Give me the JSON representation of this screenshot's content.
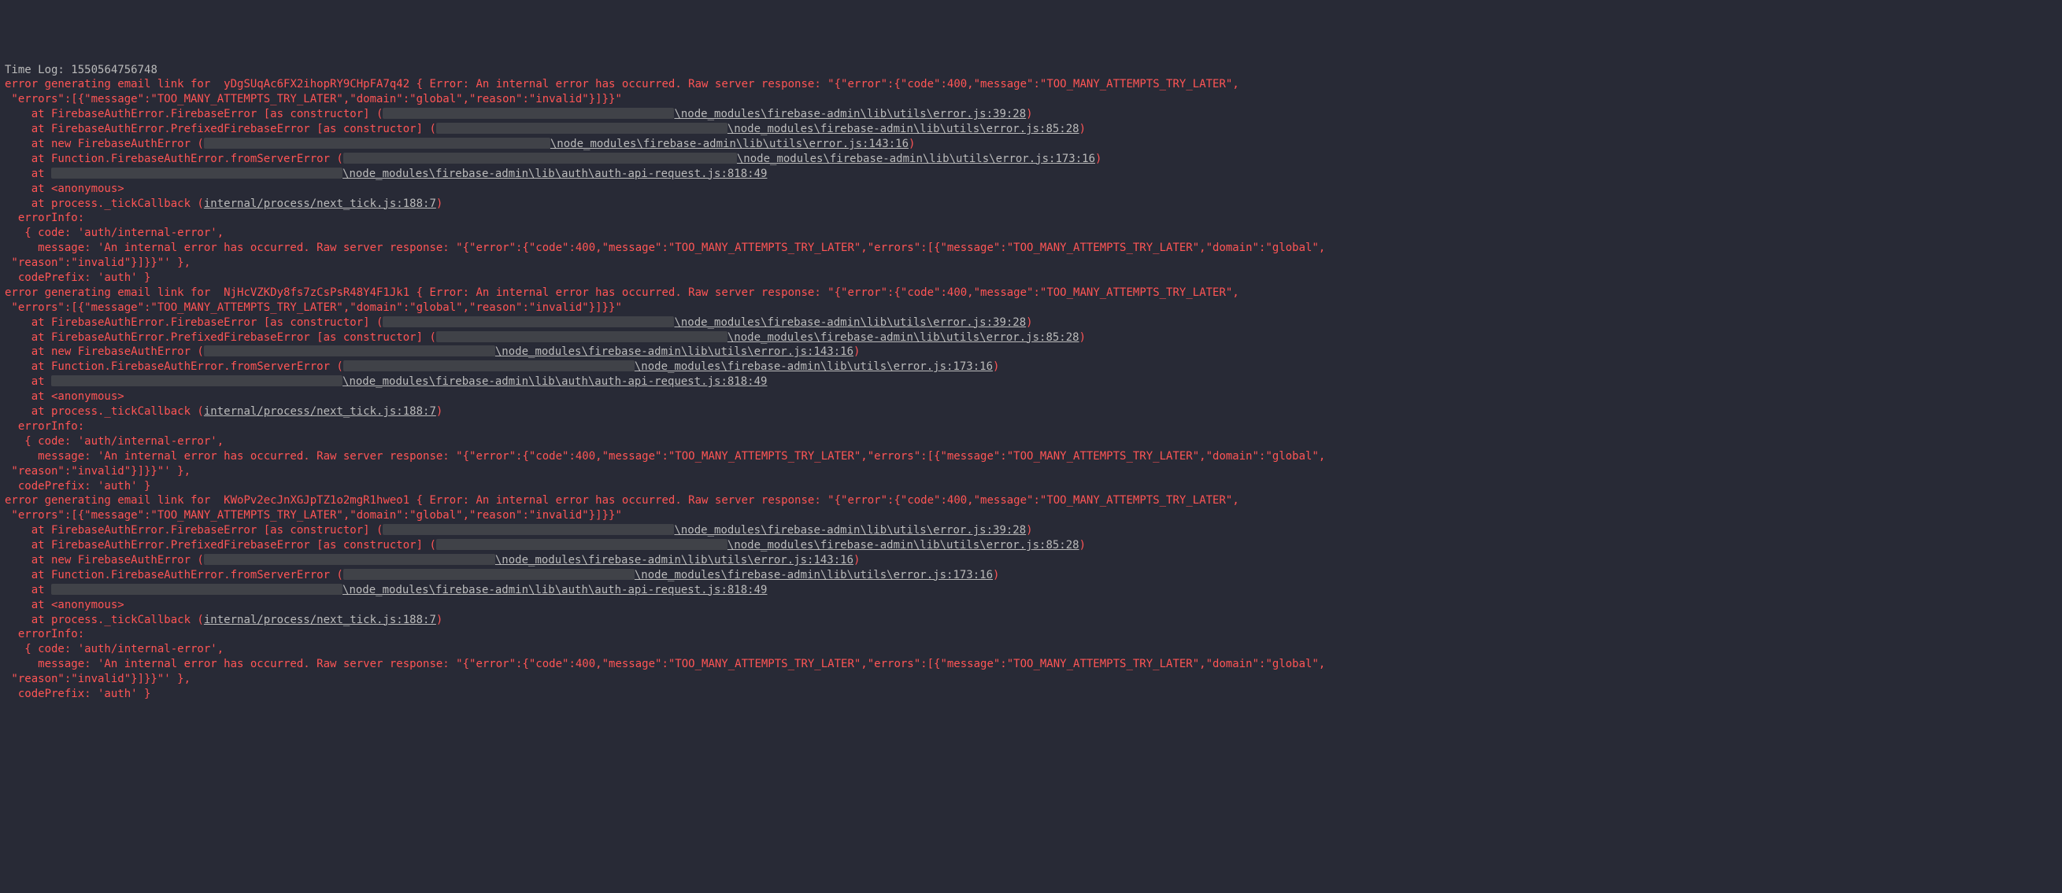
{
  "timeLabel": "Time Log: ",
  "timestamp": "1550564756748",
  "tickCallbackLink": "internal/process/next_tick.js:188:7",
  "errors": [
    {
      "userId": "yDgSUqAc6FX2ihopRY9CHpFA7q42",
      "head1": "error generating email link for  ",
      "head2": " { Error: An internal error has occurred. Raw server response: \"{\"error\":{\"code\":400,\"message\":\"TOO_MANY_ATTEMPTS_TRY_LATER\",",
      "head3": " \"errors\":[{\"message\":\"TOO_MANY_ATTEMPTS_TRY_LATER\",\"domain\":\"global\",\"reason\":\"invalid\"}]}}\"",
      "stack": [
        {
          "prefix": "    at FirebaseAuthError.FirebaseError [as constructor] (",
          "redactW": 370,
          "suffix": "\\node_modules\\firebase-admin\\lib\\utils\\error.js:39:28",
          "tail": ")"
        },
        {
          "prefix": "    at FirebaseAuthError.PrefixedFirebaseError [as constructor] (",
          "redactW": 370,
          "suffix": "\\node_modules\\firebase-admin\\lib\\utils\\error.js:85:28",
          "tail": ")"
        },
        {
          "prefix": "    at new FirebaseAuthError (",
          "redactW": 440,
          "suffix": "\\node_modules\\firebase-admin\\lib\\utils\\error.js:143:16",
          "tail": ")"
        },
        {
          "prefix": "    at Function.FirebaseAuthError.fromServerError (",
          "redactW": 500,
          "suffix": "\\node_modules\\firebase-admin\\lib\\utils\\error.js:173:16",
          "tail": ")"
        },
        {
          "prefix": "    at ",
          "redactW": 370,
          "suffix": "\\node_modules\\firebase-admin\\lib\\auth\\auth-api-request.js:818:49",
          "tail": ""
        },
        {
          "prefix": "    at <anonymous>",
          "redactW": 0,
          "suffix": "",
          "tail": ""
        }
      ],
      "tickLine": "    at process._tickCallback (",
      "tickTail": ")",
      "infoLine": "  errorInfo:",
      "codeLine": "   { code: 'auth/internal-error',",
      "msgLine": "     message: 'An internal error has occurred. Raw server response: \"{\"error\":{\"code\":400,\"message\":\"TOO_MANY_ATTEMPTS_TRY_LATER\",\"errors\":[{\"message\":\"TOO_MANY_ATTEMPTS_TRY_LATER\",\"domain\":\"global\",",
      "msgLine2": " \"reason\":\"invalid\"}]}}\"' },",
      "prefixLine": "  codePrefix: 'auth' }"
    },
    {
      "userId": "NjHcVZKDy8fs7zCsPsR48Y4F1Jk1",
      "head1": "error generating email link for  ",
      "head2": " { Error: An internal error has occurred. Raw server response: \"{\"error\":{\"code\":400,\"message\":\"TOO_MANY_ATTEMPTS_TRY_LATER\",",
      "head3": " \"errors\":[{\"message\":\"TOO_MANY_ATTEMPTS_TRY_LATER\",\"domain\":\"global\",\"reason\":\"invalid\"}]}}\"",
      "stack": [
        {
          "prefix": "    at FirebaseAuthError.FirebaseError [as constructor] (",
          "redactW": 370,
          "suffix": "\\node_modules\\firebase-admin\\lib\\utils\\error.js:39:28",
          "tail": ")"
        },
        {
          "prefix": "    at FirebaseAuthError.PrefixedFirebaseError [as constructor] (",
          "redactW": 370,
          "suffix": "\\node_modules\\firebase-admin\\lib\\utils\\error.js:85:28",
          "tail": ")"
        },
        {
          "prefix": "    at new FirebaseAuthError (",
          "redactW": 370,
          "suffix": "\\node_modules\\firebase-admin\\lib\\utils\\error.js:143:16",
          "tail": ")"
        },
        {
          "prefix": "    at Function.FirebaseAuthError.fromServerError (",
          "redactW": 370,
          "suffix": "\\node_modules\\firebase-admin\\lib\\utils\\error.js:173:16",
          "tail": ")"
        },
        {
          "prefix": "    at ",
          "redactW": 370,
          "suffix": "\\node_modules\\firebase-admin\\lib\\auth\\auth-api-request.js:818:49",
          "tail": ""
        },
        {
          "prefix": "    at <anonymous>",
          "redactW": 0,
          "suffix": "",
          "tail": ""
        }
      ],
      "tickLine": "    at process._tickCallback (",
      "tickTail": ")",
      "infoLine": "  errorInfo:",
      "codeLine": "   { code: 'auth/internal-error',",
      "msgLine": "     message: 'An internal error has occurred. Raw server response: \"{\"error\":{\"code\":400,\"message\":\"TOO_MANY_ATTEMPTS_TRY_LATER\",\"errors\":[{\"message\":\"TOO_MANY_ATTEMPTS_TRY_LATER\",\"domain\":\"global\",",
      "msgLine2": " \"reason\":\"invalid\"}]}}\"' },",
      "prefixLine": "  codePrefix: 'auth' }"
    },
    {
      "userId": "KWoPv2ecJnXGJpTZ1o2mgR1hweo1",
      "head1": "error generating email link for  ",
      "head2": " { Error: An internal error has occurred. Raw server response: \"{\"error\":{\"code\":400,\"message\":\"TOO_MANY_ATTEMPTS_TRY_LATER\",",
      "head3": " \"errors\":[{\"message\":\"TOO_MANY_ATTEMPTS_TRY_LATER\",\"domain\":\"global\",\"reason\":\"invalid\"}]}}\"",
      "stack": [
        {
          "prefix": "    at FirebaseAuthError.FirebaseError [as constructor] (",
          "redactW": 370,
          "suffix": "\\node_modules\\firebase-admin\\lib\\utils\\error.js:39:28",
          "tail": ")"
        },
        {
          "prefix": "    at FirebaseAuthError.PrefixedFirebaseError [as constructor] (",
          "redactW": 370,
          "suffix": "\\node_modules\\firebase-admin\\lib\\utils\\error.js:85:28",
          "tail": ")"
        },
        {
          "prefix": "    at new FirebaseAuthError (",
          "redactW": 370,
          "suffix": "\\node_modules\\firebase-admin\\lib\\utils\\error.js:143:16",
          "tail": ")"
        },
        {
          "prefix": "    at Function.FirebaseAuthError.fromServerError (",
          "redactW": 370,
          "suffix": "\\node_modules\\firebase-admin\\lib\\utils\\error.js:173:16",
          "tail": ")"
        },
        {
          "prefix": "    at ",
          "redactW": 370,
          "suffix": "\\node_modules\\firebase-admin\\lib\\auth\\auth-api-request.js:818:49",
          "tail": ""
        },
        {
          "prefix": "    at <anonymous>",
          "redactW": 0,
          "suffix": "",
          "tail": ""
        }
      ],
      "tickLine": "    at process._tickCallback (",
      "tickTail": ")",
      "infoLine": "  errorInfo:",
      "codeLine": "   { code: 'auth/internal-error',",
      "msgLine": "     message: 'An internal error has occurred. Raw server response: \"{\"error\":{\"code\":400,\"message\":\"TOO_MANY_ATTEMPTS_TRY_LATER\",\"errors\":[{\"message\":\"TOO_MANY_ATTEMPTS_TRY_LATER\",\"domain\":\"global\",",
      "msgLine2": " \"reason\":\"invalid\"}]}}\"' },",
      "prefixLine": "  codePrefix: 'auth' }"
    }
  ]
}
